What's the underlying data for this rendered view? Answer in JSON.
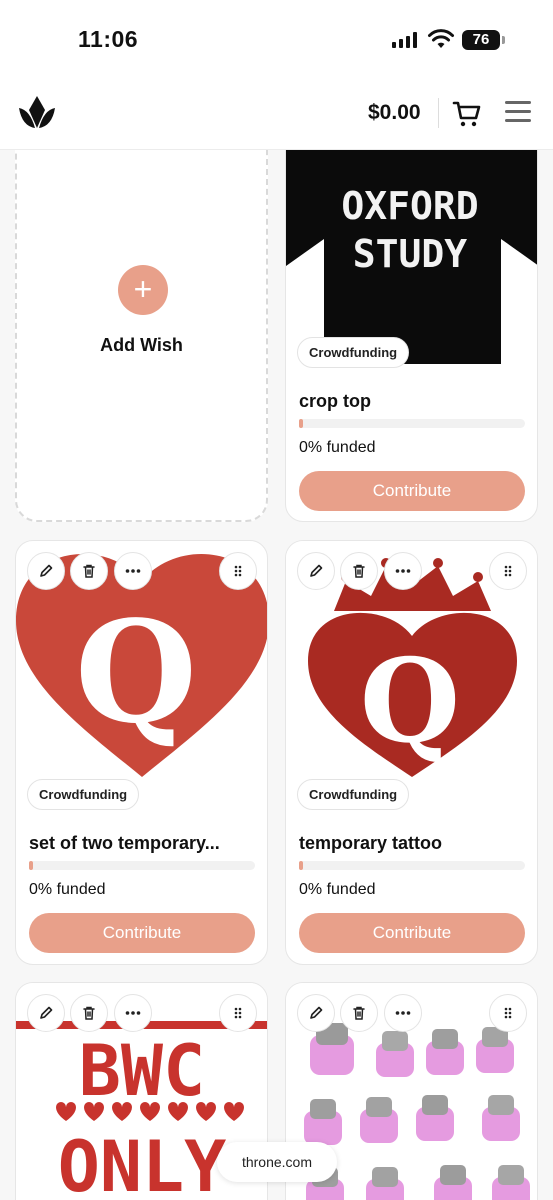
{
  "status": {
    "time": "11:06",
    "battery": "76"
  },
  "header": {
    "balance": "$0.00"
  },
  "add_wish": {
    "plus": "+",
    "label": "Add Wish"
  },
  "cards": [
    {
      "image_text": [
        "OXFORD",
        "STUDY"
      ],
      "badge": "Crowdfunding",
      "title": "crop top",
      "progress_percent": 0,
      "funded": "0% funded",
      "button": "Contribute"
    },
    {
      "image_text": [
        "Q"
      ],
      "badge": "Crowdfunding",
      "title": "set of two temporary...",
      "progress_percent": 0,
      "funded": "0% funded",
      "button": "Contribute"
    },
    {
      "image_text": [
        "Q"
      ],
      "badge": "Crowdfunding",
      "title": "temporary tattoo",
      "progress_percent": 0,
      "funded": "0% funded",
      "button": "Contribute"
    },
    {
      "image_text": [
        "BWC",
        "ONLY"
      ]
    },
    {
      "image_text": []
    }
  ],
  "toast": "throne.com",
  "colors": {
    "accent": "#e8a08a",
    "heart_red": "#c9483a",
    "heart_dark": "#a92a22"
  }
}
